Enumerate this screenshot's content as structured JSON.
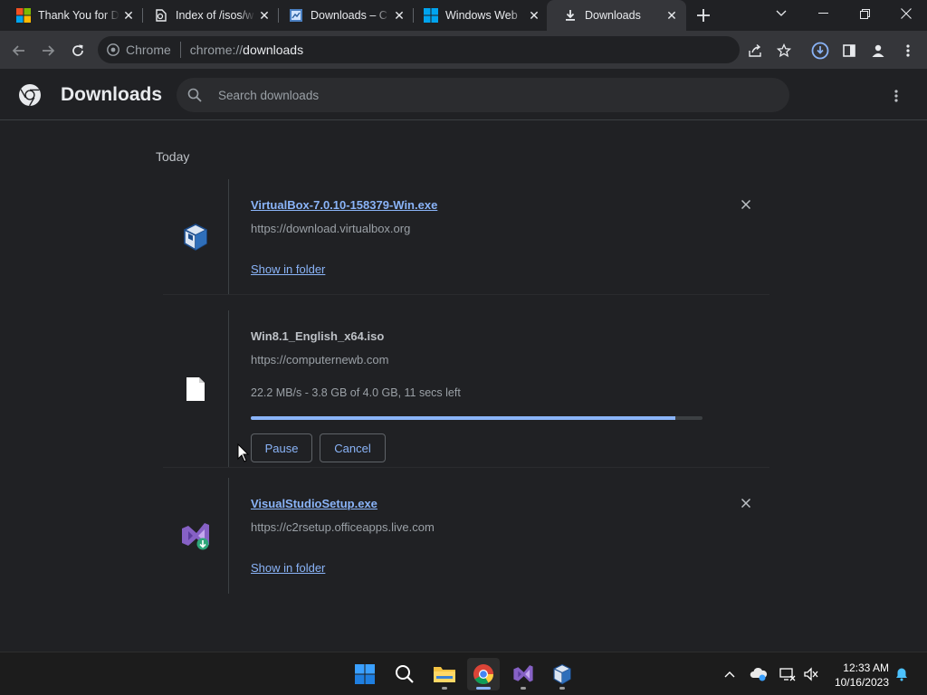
{
  "browser": {
    "tabs": [
      {
        "title": "Thank You for D",
        "icon": "microsoft-icon",
        "active": false
      },
      {
        "title": "Index of /isos/w",
        "icon": "index-site-icon",
        "active": false
      },
      {
        "title": "Downloads – C",
        "icon": "page-icon",
        "active": false
      },
      {
        "title": "Windows Web",
        "icon": "windows-icon",
        "active": false
      },
      {
        "title": "Downloads",
        "icon": "download-icon",
        "active": true
      }
    ],
    "omnibox": {
      "chip": "Chrome",
      "url_scheme": "chrome://",
      "url_host": "downloads"
    }
  },
  "downloads_page": {
    "title": "Downloads",
    "search_placeholder": "Search downloads",
    "date_group": "Today",
    "items": [
      {
        "filename": "VirtualBox-7.0.10-158379-Win.exe",
        "source": "https://download.virtualbox.org",
        "action": "Show in folder",
        "icon": "virtualbox-icon"
      },
      {
        "filename": "Win8.1_English_x64.iso",
        "source": "https://computernewb.com",
        "status": "22.2 MB/s - 3.8 GB of 4.0 GB, 11 secs left",
        "progress": 0.94,
        "pause_label": "Pause",
        "cancel_label": "Cancel",
        "icon": "file-icon"
      },
      {
        "filename": "VisualStudioSetup.exe",
        "source": "https://c2rsetup.officeapps.live.com",
        "action": "Show in folder",
        "icon": "visual-studio-installer-icon"
      }
    ]
  },
  "taskbar": {
    "clock_time": "12:33 AM",
    "clock_date": "10/16/2023"
  },
  "colors": {
    "accent": "#8ab4f8",
    "background": "#202124",
    "toolbar": "#35363a"
  }
}
